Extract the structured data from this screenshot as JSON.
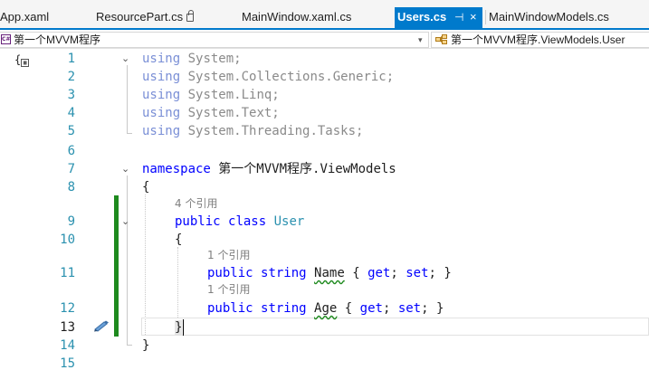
{
  "tabs": [
    {
      "label": "App.xaml"
    },
    {
      "label": "ResourcePart.cs",
      "locked": true
    },
    {
      "label": "MainWindow.xaml.cs"
    },
    {
      "label": "Users.cs",
      "active": true
    },
    {
      "label": "MainWindowModels.cs"
    }
  ],
  "active_tab_controls": {
    "pin": "⊣",
    "close": "×"
  },
  "navbar": {
    "project_badge": "C#",
    "project": "第一个MVVM程序",
    "type": "第一个MVVM程序.ViewModels.User"
  },
  "indicator_icon": "{",
  "line_numbers": [
    "1",
    "2",
    "3",
    "4",
    "5",
    "6",
    "7",
    "8",
    "9",
    "10",
    "11",
    "12",
    "13",
    "14",
    "15"
  ],
  "current_line": "13",
  "code": {
    "using_system": {
      "kw": "using",
      "ns": "System;"
    },
    "using_collections": {
      "kw": "using",
      "ns": "System.Collections.Generic;"
    },
    "using_linq": {
      "kw": "using",
      "ns": "System.Linq;"
    },
    "using_text": {
      "kw": "using",
      "ns": "System.Text;"
    },
    "using_tasks": {
      "kw": "using",
      "ns": "System.Threading.Tasks;"
    },
    "namespace_kw": "namespace",
    "namespace_name": "第一个MVVM程序.ViewModels",
    "open_brace": "{",
    "close_brace": "}",
    "class_refs": "4 个引用",
    "class_public": "public",
    "class_kw": "class",
    "class_name": "User",
    "name_refs": "1 个引用",
    "name_line": {
      "public": "public",
      "type": "string",
      "name": "Name",
      "open": "{",
      "get": "get",
      "semi1": ";",
      "set": "set",
      "semi2": ";",
      "close": "}"
    },
    "age_refs": "1 个引用",
    "age_line": {
      "public": "public",
      "type": "string",
      "name": "Age",
      "open": "{",
      "get": "get",
      "semi1": ";",
      "set": "set",
      "semi2": ";",
      "close": "}"
    }
  },
  "colors": {
    "accent": "#007acc",
    "keyword": "#0000ff",
    "type": "#2b91af",
    "change_bar": "#1e8a1e"
  }
}
